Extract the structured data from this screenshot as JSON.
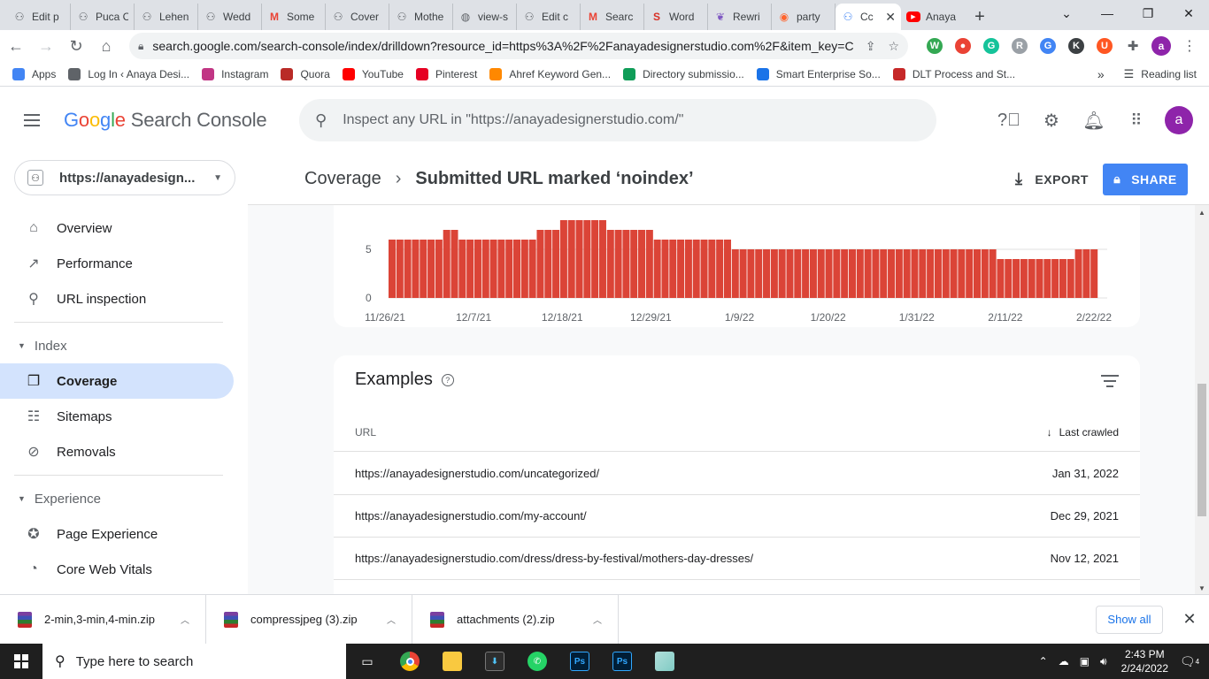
{
  "browser": {
    "tabs": [
      {
        "title": "Edit p",
        "icon": "gsc",
        "color": "#5f6368"
      },
      {
        "title": "Puca C",
        "icon": "gsc",
        "color": "#5f6368"
      },
      {
        "title": "Lehen",
        "icon": "gsc",
        "color": "#5f6368"
      },
      {
        "title": "Wedd",
        "icon": "gsc",
        "color": "#5f6368"
      },
      {
        "title": "Some",
        "icon": "gmail",
        "color": "#ea4335"
      },
      {
        "title": "Cover",
        "icon": "gsc",
        "color": "#5f6368"
      },
      {
        "title": "Mothe",
        "icon": "gsc",
        "color": "#5f6368"
      },
      {
        "title": "view-s",
        "icon": "globe",
        "color": "#5f6368"
      },
      {
        "title": "Edit c",
        "icon": "gsc",
        "color": "#5f6368"
      },
      {
        "title": "Searc",
        "icon": "gmail",
        "color": "#ea4335"
      },
      {
        "title": "Word",
        "icon": "s",
        "color": "#d93025"
      },
      {
        "title": "Rewri",
        "icon": "leaf",
        "color": "#7e57c2"
      },
      {
        "title": "party",
        "icon": "semrush",
        "color": "#ff642d"
      }
    ],
    "active_tab": {
      "title": "Cc",
      "close": "✕"
    },
    "last_tab": {
      "title": "Anaya",
      "icon": "youtube",
      "color": "#ff0000"
    },
    "new_tab": "+",
    "url": "search.google.com/search-console/index/drilldown?resource_id=https%3A%2F%2Fanayadesignerstudio.com%2F&item_key=C...",
    "bookmarks": [
      {
        "label": "Apps",
        "color": "#4285f4"
      },
      {
        "label": "Log In ‹ Anaya Desi...",
        "color": "#5f6368"
      },
      {
        "label": "Instagram",
        "color": "#c13584"
      },
      {
        "label": "Quora",
        "color": "#b92b27"
      },
      {
        "label": "YouTube",
        "color": "#ff0000"
      },
      {
        "label": "Pinterest",
        "color": "#e60023"
      },
      {
        "label": "Ahref Keyword Gen...",
        "color": "#ff8800"
      },
      {
        "label": "Directory submissio...",
        "color": "#0f9d58"
      },
      {
        "label": "Smart Enterprise So...",
        "color": "#1a73e8"
      },
      {
        "label": "DLT Process and St...",
        "color": "#c62828"
      }
    ],
    "bookmarks_more": "»",
    "reading_list": "Reading list",
    "extensions": [
      {
        "letter": "W",
        "color": "#34a853"
      },
      {
        "letter": "●",
        "color": "#ea4335"
      },
      {
        "letter": "G",
        "color": "#15c39a"
      },
      {
        "letter": "R",
        "color": "#9aa0a6"
      },
      {
        "letter": "G",
        "color": "#4285f4"
      },
      {
        "letter": "K",
        "color": "#3c4043"
      },
      {
        "letter": "U",
        "color": "#ff5722"
      }
    ],
    "profile_letter": "a"
  },
  "header": {
    "logo": {
      "g1": "G",
      "g2": "o",
      "g3": "o",
      "g4": "g",
      "g5": "l",
      "g6": "e",
      "product": " Search Console"
    },
    "search_placeholder": "Inspect any URL in \"https://anayadesignerstudio.com/\"",
    "avatar_letter": "a"
  },
  "sidebar": {
    "property": "https://anayadesign...",
    "items": [
      {
        "label": "Overview",
        "icon": "⌂"
      },
      {
        "label": "Performance",
        "icon": "↗"
      },
      {
        "label": "URL inspection",
        "icon": "⚲"
      }
    ],
    "index_section": "Index",
    "index_items": [
      {
        "label": "Coverage",
        "icon": "❐"
      },
      {
        "label": "Sitemaps",
        "icon": "☷"
      },
      {
        "label": "Removals",
        "icon": "⊘"
      }
    ],
    "experience_section": "Experience",
    "experience_items": [
      {
        "label": "Page Experience",
        "icon": "✪"
      },
      {
        "label": "Core Web Vitals",
        "icon": "◔"
      }
    ]
  },
  "breadcrumb": {
    "parent": "Coverage",
    "separator": "›",
    "current": "Submitted URL marked ‘noindex’",
    "export": "EXPORT",
    "share": "SHARE"
  },
  "chart_data": {
    "type": "bar",
    "x_tick_labels": [
      "11/26/21",
      "12/7/21",
      "12/18/21",
      "12/29/21",
      "1/9/22",
      "1/20/22",
      "1/31/22",
      "2/11/22",
      "2/22/22"
    ],
    "y_tick_labels": [
      "0",
      "5"
    ],
    "color": "#db4437",
    "values": [
      6,
      6,
      6,
      6,
      6,
      6,
      6,
      7,
      7,
      6,
      6,
      6,
      6,
      6,
      6,
      6,
      6,
      6,
      6,
      7,
      7,
      7,
      8,
      8,
      8,
      8,
      8,
      8,
      7,
      7,
      7,
      7,
      7,
      7,
      6,
      6,
      6,
      6,
      6,
      6,
      6,
      6,
      6,
      6,
      5,
      5,
      5,
      5,
      5,
      5,
      5,
      5,
      5,
      5,
      5,
      5,
      5,
      5,
      5,
      5,
      5,
      5,
      5,
      5,
      5,
      5,
      5,
      5,
      5,
      5,
      5,
      5,
      5,
      5,
      5,
      5,
      5,
      5,
      4,
      4,
      4,
      4,
      4,
      4,
      4,
      4,
      4,
      4,
      5,
      5,
      5
    ]
  },
  "examples": {
    "title": "Examples",
    "col_url": "URL",
    "col_crawled": "Last crawled",
    "sort_arrow": "↓",
    "rows": [
      {
        "url": "https://anayadesignerstudio.com/uncategorized/",
        "date": "Jan 31, 2022"
      },
      {
        "url": "https://anayadesignerstudio.com/my-account/",
        "date": "Dec 29, 2021"
      },
      {
        "url": "https://anayadesignerstudio.com/dress/dress-by-festival/mothers-day-dresses/",
        "date": "Nov 12, 2021"
      }
    ]
  },
  "downloads": {
    "items": [
      "2-min,3-min,4-min.zip",
      "compressjpeg (3).zip",
      "attachments (2).zip"
    ],
    "show_all": "Show all"
  },
  "taskbar": {
    "search_placeholder": "Type here to search",
    "time": "2:43 PM",
    "date": "2/24/2022",
    "notifications": "4"
  }
}
